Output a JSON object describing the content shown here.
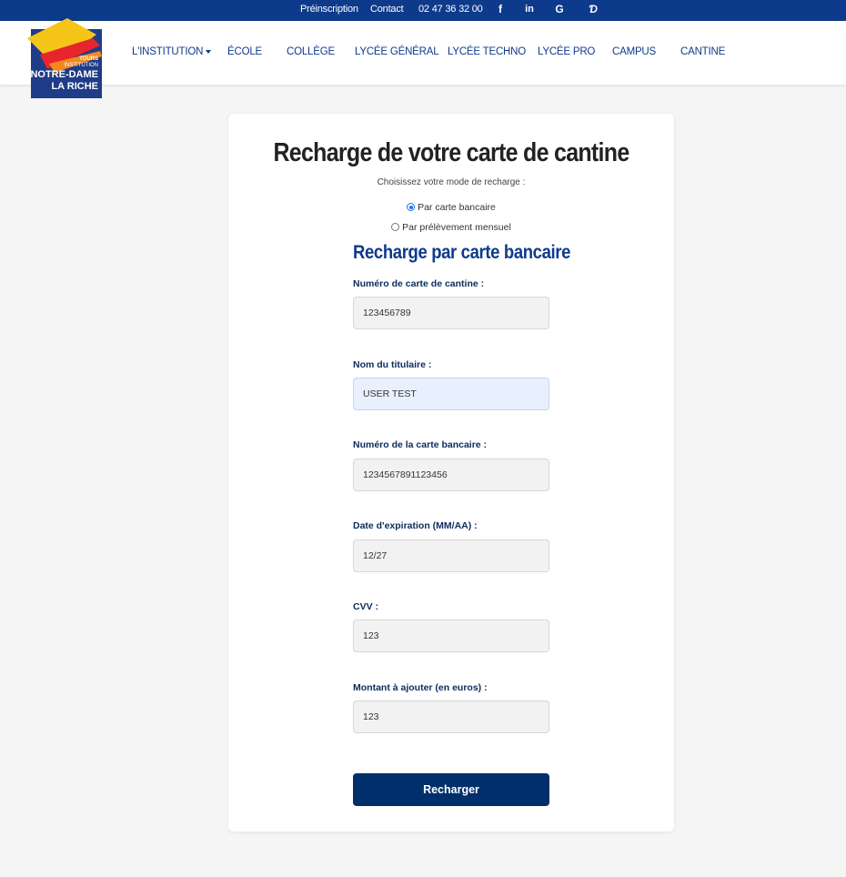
{
  "topbar": {
    "preinscription": "Préinscription",
    "contact": "Contact",
    "phone": "02 47 36 32 00",
    "icons": [
      "facebook-icon",
      "linkedin-icon",
      "google-icon",
      "ecole-directe-icon"
    ],
    "icon_glyphs": [
      "f",
      "in",
      "G",
      "Ɗ"
    ]
  },
  "logo": {
    "line1": "TOURS",
    "line2": "INSTITUTION",
    "line3": "NOTRE-DAME",
    "line4": "LA RICHE"
  },
  "nav": {
    "items": [
      "L'INSTITUTION",
      "ÉCOLE",
      "COLLÈGE",
      "LYCÉE GÉNÉRAL",
      "LYCÉE TECHNO",
      "LYCÉE PRO",
      "CAMPUS",
      "CANTINE"
    ]
  },
  "main": {
    "title": "Recharge de votre carte de cantine",
    "subtitle": "Choisissez votre mode de recharge :",
    "options": [
      {
        "label": "Par carte bancaire",
        "checked": true
      },
      {
        "label": "Par prélèvement mensuel",
        "checked": false
      }
    ],
    "section_title": "Recharge par carte bancaire",
    "fields": [
      {
        "label": "Numéro de carte de cantine :",
        "value": "123456789"
      },
      {
        "label": "Nom du titulaire :",
        "value": "USER TEST"
      },
      {
        "label": "Numéro de la carte bancaire :",
        "value": "1234567891123456"
      },
      {
        "label": "Date d'expiration (MM/AA) :",
        "value": "12/27"
      },
      {
        "label": "CVV :",
        "value": "123"
      },
      {
        "label": "Montant à ajouter (en euros) :",
        "value": "123"
      }
    ],
    "submit_label": "Recharger"
  },
  "colors": {
    "brand_blue": "#0e3a8c",
    "button": "#002f6c",
    "radio_accent": "#1a73e8",
    "logo_bg": "#1f3c88"
  }
}
